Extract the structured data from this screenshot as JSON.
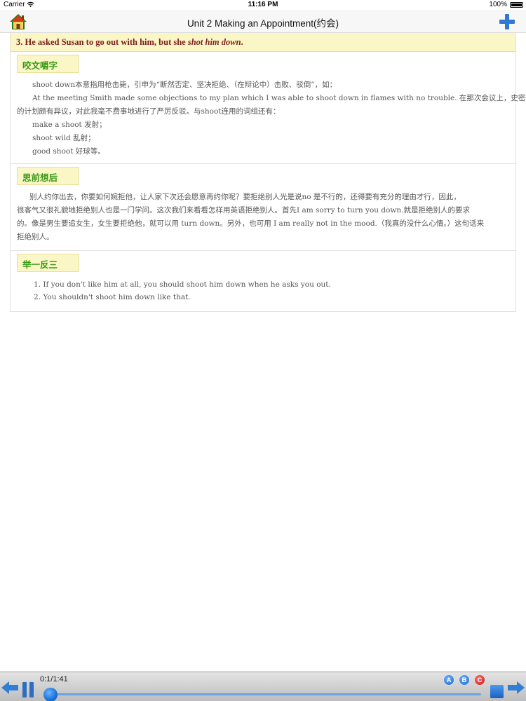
{
  "status": {
    "carrier": "Carrier",
    "time": "11:16 PM",
    "battery": "100%",
    "battery_level": 1.0
  },
  "nav": {
    "title": "Unit 2 Making an Appointment(约会)",
    "home_icon": "home-icon",
    "add_icon": "plus-icon"
  },
  "heading": {
    "prefix": "3. He asked Susan to go out with him, but she ",
    "emphasis": "shot him down",
    "suffix": "."
  },
  "sections": [
    {
      "tag": "咬文嚼字",
      "lines": [
        "shoot down本意指用枪击毙，引申为“断然否定、坚决拒绝、（在辩论中）击败、驳倒”，如：",
        "At the meeting Smith made some objections to my plan which I was able to shoot down in flames with no trouble. 在那次会议上，史密斯对我",
        "的计划颇有异议，对此我毫不费事地进行了严厉反驳。与shoot连用的词组还有：",
        "make a shoot 发射；",
        "shoot wild 乱射；",
        "good shoot 好球等。"
      ]
    },
    {
      "tag": "思前想后",
      "lines": [
        "别人约你出去，你要如何婉拒他，让人家下次还会愿意再约你呢？要拒绝别人光是说no 是不行的，还得要有充分的理由才行，因此，",
        "很客气又很礼貌地拒绝别人也是一门学问。这次我们来看看怎样用英语拒绝别人。首先I am sorry to turn you down.就是拒绝别人的要求",
        "的。像是男生要追女生，女生要拒绝他，就可以用 turn down。另外，也可用 I am really not in the mood.（我真的没什么心情。）这句话来",
        "拒绝别人。"
      ]
    },
    {
      "tag": "举一反三",
      "lines": [
        "1.  If you don't like him at all, you should shoot him down when he asks you out.",
        "2.  You shouldn't shoot him down like that."
      ]
    }
  ],
  "player": {
    "time_label": "0:1/1:41",
    "progress": 0.0101,
    "a_label": "A",
    "b_label": "B",
    "c_label": "C"
  }
}
